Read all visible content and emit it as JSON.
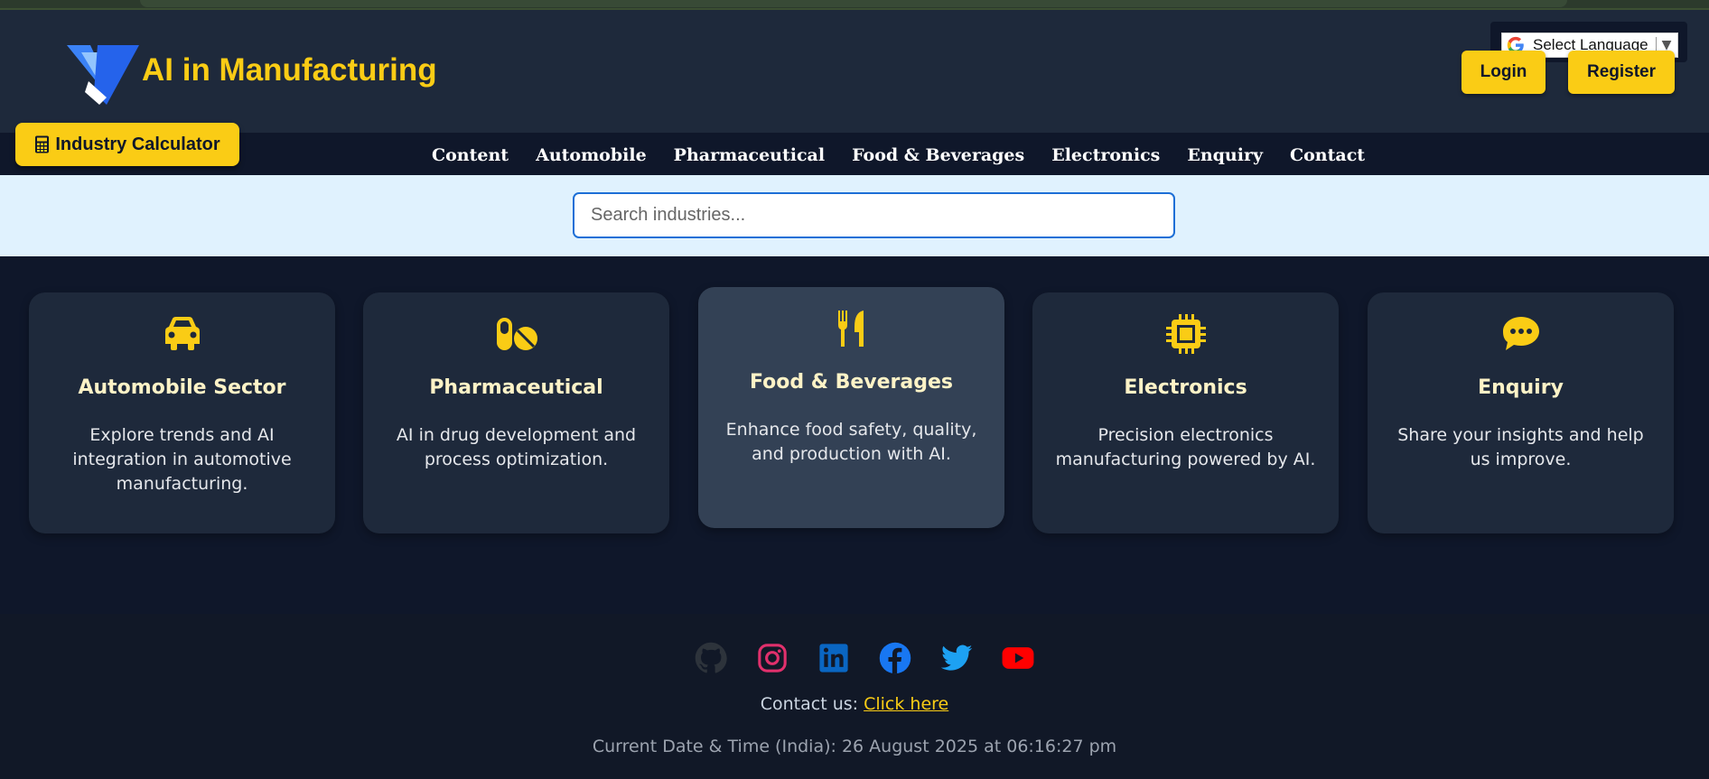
{
  "header": {
    "brand": "AI in Manufacturing",
    "logo_icon": "vt-logo-icon",
    "language_select": "Select Language",
    "login_label": "Login",
    "register_label": "Register",
    "calculator_label": "Industry Calculator"
  },
  "nav": {
    "items": [
      {
        "label": "Content"
      },
      {
        "label": "Automobile"
      },
      {
        "label": "Pharmaceutical"
      },
      {
        "label": "Food & Beverages"
      },
      {
        "label": "Electronics"
      },
      {
        "label": "Enquiry"
      },
      {
        "label": "Contact"
      }
    ]
  },
  "search": {
    "placeholder": "Search industries..."
  },
  "cards": [
    {
      "icon": "car-icon",
      "title": "Automobile Sector",
      "desc": "Explore trends and AI integration in automotive manufacturing."
    },
    {
      "icon": "pills-icon",
      "title": "Pharmaceutical",
      "desc": "AI in drug development and process optimization."
    },
    {
      "icon": "utensils-icon",
      "title": "Food & Beverages",
      "desc": "Enhance food safety, quality, and production with AI."
    },
    {
      "icon": "microchip-icon",
      "title": "Electronics",
      "desc": "Precision electronics manufacturing powered by AI."
    },
    {
      "icon": "comment-icon",
      "title": "Enquiry",
      "desc": "Share your insights and help us improve."
    }
  ],
  "footer": {
    "socials": [
      "github-icon",
      "instagram-icon",
      "linkedin-icon",
      "facebook-icon",
      "twitter-icon",
      "youtube-icon"
    ],
    "contact_prefix": "Contact us:",
    "contact_link": "Click here",
    "datetime": "Current Date & Time (India): 26 August 2025 at 06:16:27 pm"
  },
  "colors": {
    "accent": "#facc15",
    "background": "#0f172a",
    "card": "#1e293b",
    "card_active": "#334155",
    "search_band": "#e0f2fe"
  }
}
